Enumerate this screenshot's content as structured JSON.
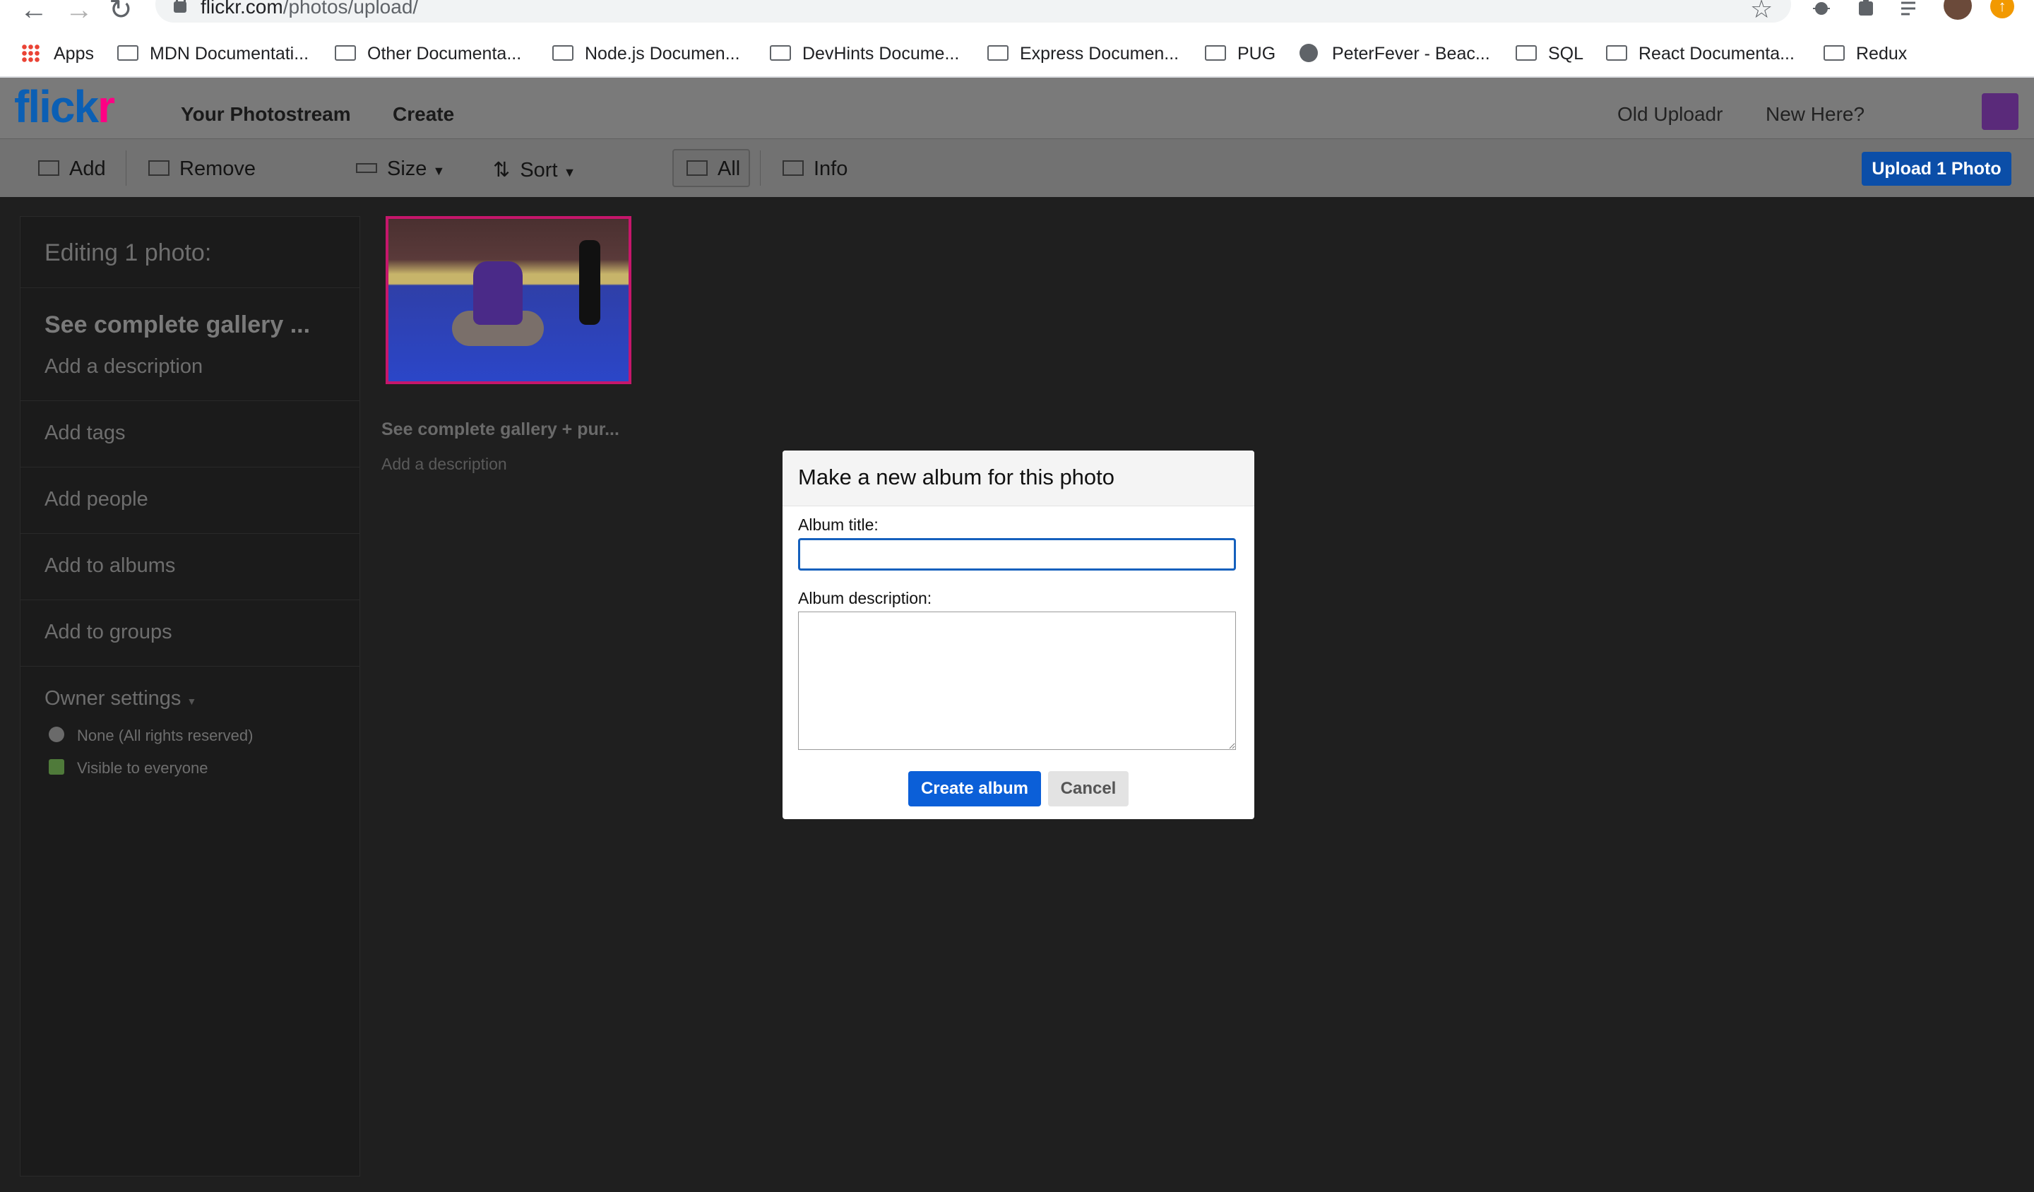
{
  "browser": {
    "url_host": "flickr.com",
    "url_path": "/photos/upload/",
    "bookmarks": [
      {
        "label": "Apps",
        "icon": "apps-grid-icon"
      },
      {
        "label": "MDN Documentati...",
        "icon": "folder-icon"
      },
      {
        "label": "Other Documenta...",
        "icon": "folder-icon"
      },
      {
        "label": "Node.js Documen...",
        "icon": "folder-icon"
      },
      {
        "label": "DevHints Docume...",
        "icon": "folder-icon"
      },
      {
        "label": "Express Documen...",
        "icon": "folder-icon"
      },
      {
        "label": "PUG",
        "icon": "folder-icon"
      },
      {
        "label": "PeterFever - Beac...",
        "icon": "globe-icon"
      },
      {
        "label": "SQL",
        "icon": "folder-icon"
      },
      {
        "label": "React Documenta...",
        "icon": "folder-icon"
      },
      {
        "label": "Redux",
        "icon": "folder-icon"
      }
    ]
  },
  "header": {
    "logo_main": "flick",
    "logo_r": "r",
    "nav": [
      "Your Photostream",
      "Create"
    ],
    "right_nav": [
      "Old Uploadr",
      "New Here?"
    ]
  },
  "toolbar": {
    "add": "Add",
    "remove": "Remove",
    "size": "Size",
    "sort": "Sort",
    "all": "All",
    "info": "Info",
    "upload": "Upload 1 Photo"
  },
  "left_panel": {
    "heading": "Editing 1 photo:",
    "title": "See complete gallery ...",
    "add_description": "Add a description",
    "add_tags": "Add tags",
    "add_people": "Add people",
    "add_to_albums": "Add to albums",
    "add_to_groups": "Add to groups",
    "owner_settings": "Owner settings",
    "license": "None (All rights reserved)",
    "visibility": "Visible to everyone"
  },
  "photo": {
    "title": "See complete gallery + pur...",
    "description": "Add a description"
  },
  "modal": {
    "title": "Make a new album for this photo",
    "album_title_label": "Album title:",
    "album_title_value": "",
    "album_description_label": "Album description:",
    "album_description_value": "",
    "create_button": "Create album",
    "cancel_button": "Cancel"
  },
  "colors": {
    "flickr_blue": "#0b5fb4",
    "flickr_pink": "#ff0084",
    "primary_button": "#0b5fd8",
    "selection_border": "#c6166b"
  }
}
